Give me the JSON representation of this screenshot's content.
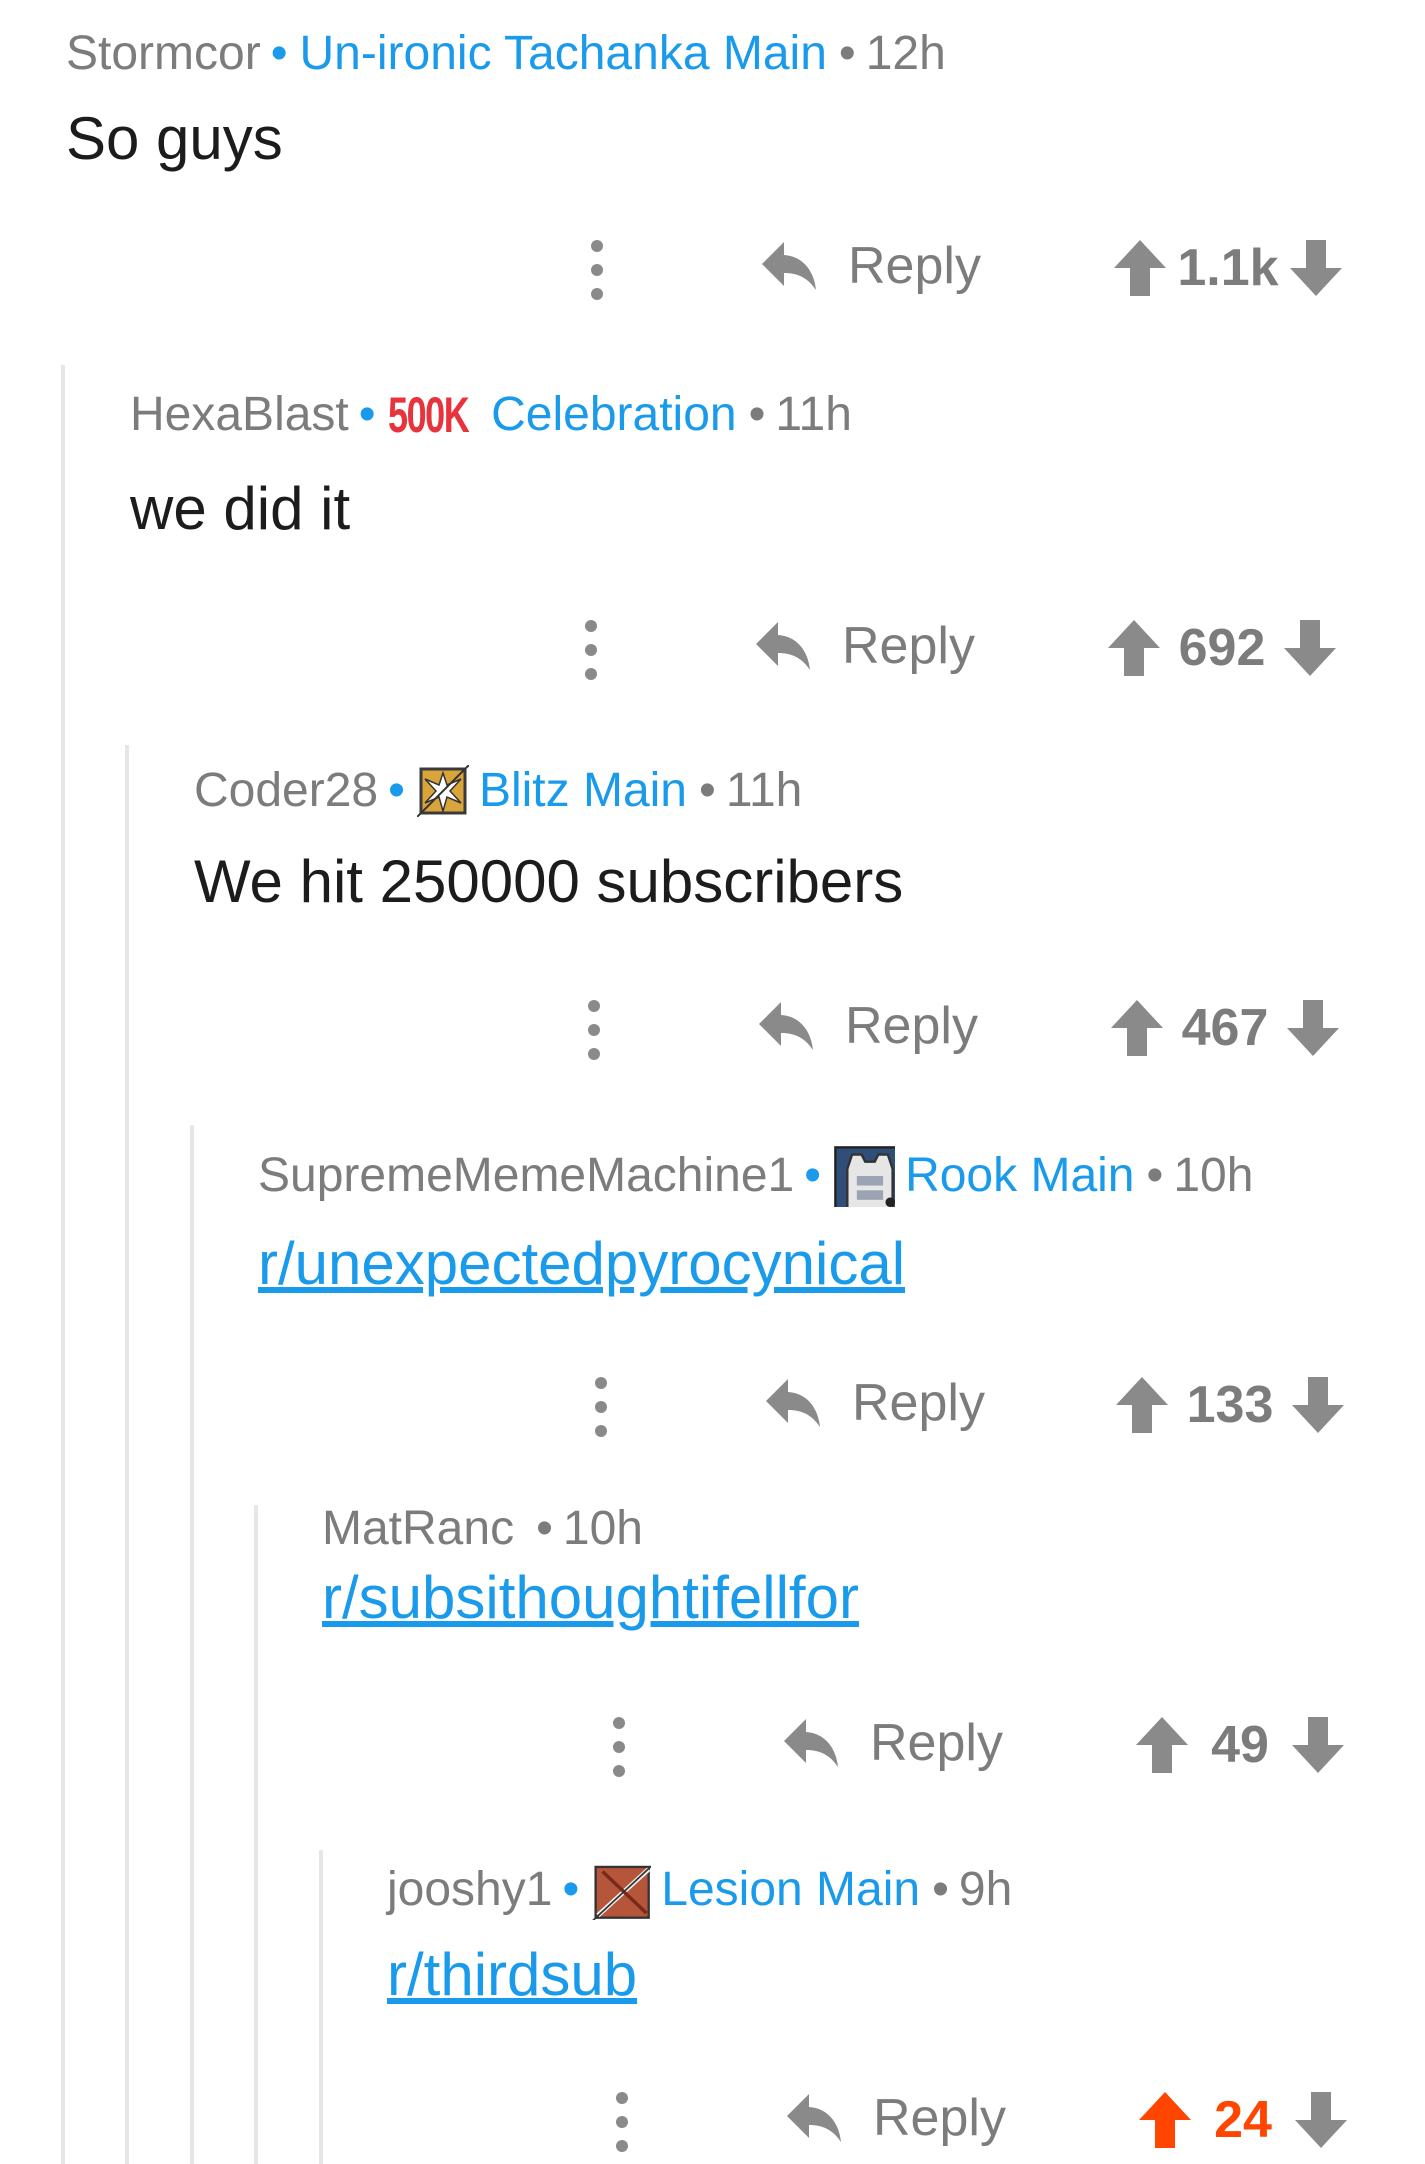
{
  "colors": {
    "accent": "#1a9aeb",
    "upvoted": "#ff4500",
    "muted": "#7c7c7c",
    "flair_500k": "#e8333c"
  },
  "comments": [
    {
      "author": "Stormcor",
      "flair": "Un-ironic Tachanka Main",
      "time": "12h",
      "body": "So guys",
      "reply_label": "Reply",
      "score": "1.1k",
      "upvoted": false
    },
    {
      "author": "HexaBlast",
      "flair_badge": "500K",
      "flair": "Celebration",
      "time": "11h",
      "body": "we did it",
      "reply_label": "Reply",
      "score": "692",
      "upvoted": false
    },
    {
      "author": "Coder28",
      "flair_icon": "blitz-shield-icon",
      "flair": "Blitz Main",
      "time": "11h",
      "body": "We hit 250000 subscribers",
      "reply_label": "Reply",
      "score": "467",
      "upvoted": false
    },
    {
      "author": "SupremeMemeMachine1",
      "flair_icon": "rook-armor-icon",
      "flair": "Rook Main",
      "time": "10h",
      "body": "r/unexpectedpyrocynical",
      "reply_label": "Reply",
      "score": "133",
      "upvoted": false
    },
    {
      "author": "MatRanc",
      "time": "10h",
      "body": "r/subsithoughtifellfor",
      "reply_label": "Reply",
      "score": "49",
      "upvoted": false
    },
    {
      "author": "jooshy1",
      "flair_icon": "lesion-needle-icon",
      "flair": "Lesion Main",
      "time": "9h",
      "body": "r/thirdsub",
      "reply_label": "Reply",
      "score": "24",
      "upvoted": true
    }
  ]
}
